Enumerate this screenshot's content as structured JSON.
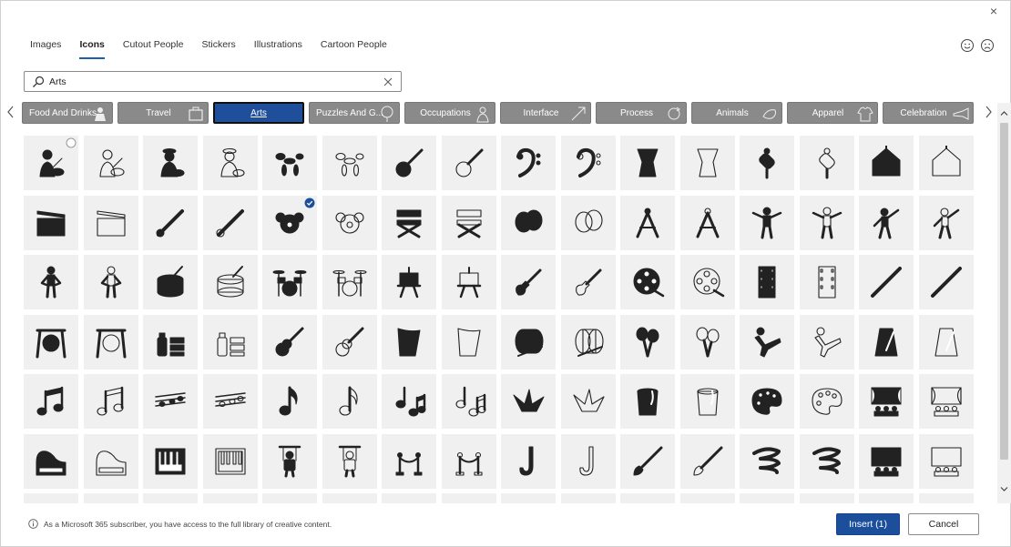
{
  "dialog": {
    "close_glyph": "×",
    "tabs": [
      {
        "label": "Images",
        "active": false
      },
      {
        "label": "Icons",
        "active": true
      },
      {
        "label": "Cutout People",
        "active": false
      },
      {
        "label": "Stickers",
        "active": false
      },
      {
        "label": "Illustrations",
        "active": false
      },
      {
        "label": "Cartoon People",
        "active": false
      }
    ],
    "feedback_icons": [
      "smile-icon",
      "frown-icon"
    ]
  },
  "search": {
    "value": "Arts",
    "placeholder": "Search"
  },
  "categories": [
    {
      "label": "Food And Drinks",
      "art": "dessert-icon",
      "active": false
    },
    {
      "label": "Travel",
      "art": "suitcase-icon",
      "active": false
    },
    {
      "label": "Arts",
      "art": "",
      "active": true
    },
    {
      "label": "Puzzles And G...",
      "art": "tree-icon",
      "active": false
    },
    {
      "label": "Occupations",
      "art": "worker-icon",
      "active": false
    },
    {
      "label": "Interface",
      "art": "arrows-icon",
      "active": false
    },
    {
      "label": "Process",
      "art": "cycle-icon",
      "active": false
    },
    {
      "label": "Animals",
      "art": "bird-icon",
      "active": false
    },
    {
      "label": "Apparel",
      "art": "shirt-icon",
      "active": false
    },
    {
      "label": "Celebration",
      "art": "horn-icon",
      "active": false
    }
  ],
  "icons": [
    {
      "name": "painter-icon",
      "filled": true,
      "mark": "circle"
    },
    {
      "name": "painter-icon",
      "filled": false
    },
    {
      "name": "painter-beret-icon",
      "filled": true
    },
    {
      "name": "painter-beret-icon",
      "filled": false
    },
    {
      "name": "balloon-dog-icon",
      "filled": true
    },
    {
      "name": "balloon-dog-icon",
      "filled": false
    },
    {
      "name": "banjo-icon",
      "filled": true
    },
    {
      "name": "banjo-icon",
      "filled": false
    },
    {
      "name": "bass-clef-icon",
      "filled": true
    },
    {
      "name": "bass-clef-icon",
      "filled": false
    },
    {
      "name": "djembe-icon",
      "filled": true
    },
    {
      "name": "djembe-icon",
      "filled": false
    },
    {
      "name": "chinese-knot-icon",
      "filled": true
    },
    {
      "name": "chinese-knot-icon",
      "filled": false
    },
    {
      "name": "circus-tent-icon",
      "filled": true
    },
    {
      "name": "circus-tent-icon",
      "filled": false
    },
    {
      "name": "clapperboard-icon",
      "filled": true
    },
    {
      "name": "clapperboard-icon",
      "filled": false
    },
    {
      "name": "clarinet-icon",
      "filled": true
    },
    {
      "name": "clarinet-icon",
      "filled": false
    },
    {
      "name": "clown-icon",
      "filled": true,
      "mark": "check"
    },
    {
      "name": "clown-icon",
      "filled": false
    },
    {
      "name": "director-chair-icon",
      "filled": true
    },
    {
      "name": "director-chair-icon",
      "filled": false
    },
    {
      "name": "theater-masks-icon",
      "filled": true
    },
    {
      "name": "theater-masks-icon",
      "filled": false
    },
    {
      "name": "drawing-compass-icon",
      "filled": true
    },
    {
      "name": "drawing-compass-icon",
      "filled": false
    },
    {
      "name": "mannequin-icon",
      "filled": true
    },
    {
      "name": "mannequin-icon",
      "filled": false
    },
    {
      "name": "mannequin-pose-icon",
      "filled": true
    },
    {
      "name": "mannequin-pose-icon",
      "filled": false
    },
    {
      "name": "mannequin-stand-icon",
      "filled": true
    },
    {
      "name": "mannequin-stand-icon",
      "filled": false
    },
    {
      "name": "drum-icon",
      "filled": true
    },
    {
      "name": "drum-icon",
      "filled": false
    },
    {
      "name": "drum-kit-icon",
      "filled": true
    },
    {
      "name": "drum-kit-icon",
      "filled": false
    },
    {
      "name": "easel-icon",
      "filled": true
    },
    {
      "name": "easel-icon",
      "filled": false
    },
    {
      "name": "electric-guitar-icon",
      "filled": true
    },
    {
      "name": "electric-guitar-icon",
      "filled": false
    },
    {
      "name": "film-reel-icon",
      "filled": true
    },
    {
      "name": "film-reel-icon",
      "filled": false
    },
    {
      "name": "film-strip-icon",
      "filled": true
    },
    {
      "name": "film-strip-icon",
      "filled": false
    },
    {
      "name": "flute-icon",
      "filled": true
    },
    {
      "name": "flute-icon",
      "filled": false
    },
    {
      "name": "gong-icon",
      "filled": true
    },
    {
      "name": "gong-icon",
      "filled": false
    },
    {
      "name": "graffiti-icon",
      "filled": true
    },
    {
      "name": "graffiti-icon",
      "filled": false
    },
    {
      "name": "acoustic-guitar-icon",
      "filled": true
    },
    {
      "name": "acoustic-guitar-icon",
      "filled": false
    },
    {
      "name": "harp-icon",
      "filled": true
    },
    {
      "name": "harp-icon",
      "filled": false
    },
    {
      "name": "marching-drum-icon",
      "filled": true
    },
    {
      "name": "marching-drum-icon",
      "filled": false
    },
    {
      "name": "maracas-icon",
      "filled": true
    },
    {
      "name": "maracas-icon",
      "filled": false
    },
    {
      "name": "martial-arts-icon",
      "filled": true
    },
    {
      "name": "martial-arts-icon",
      "filled": false
    },
    {
      "name": "metronome-icon",
      "filled": true
    },
    {
      "name": "metronome-icon",
      "filled": false
    },
    {
      "name": "beamed-notes-icon",
      "filled": true
    },
    {
      "name": "beamed-notes-icon",
      "filled": false
    },
    {
      "name": "sheet-music-icon",
      "filled": true
    },
    {
      "name": "sheet-music-icon",
      "filled": false
    },
    {
      "name": "eighth-note-icon",
      "filled": true
    },
    {
      "name": "eighth-note-icon",
      "filled": false
    },
    {
      "name": "music-notes-icon",
      "filled": true
    },
    {
      "name": "music-notes-icon",
      "filled": false
    },
    {
      "name": "origami-crane-icon",
      "filled": true
    },
    {
      "name": "origami-crane-icon",
      "filled": false
    },
    {
      "name": "paint-bucket-icon",
      "filled": true
    },
    {
      "name": "paint-bucket-icon",
      "filled": false
    },
    {
      "name": "palette-icon",
      "filled": true
    },
    {
      "name": "palette-icon",
      "filled": false
    },
    {
      "name": "stage-audience-icon",
      "filled": true
    },
    {
      "name": "stage-audience-icon",
      "filled": false
    },
    {
      "name": "grand-piano-icon",
      "filled": true
    },
    {
      "name": "grand-piano-icon",
      "filled": false
    },
    {
      "name": "piano-keys-icon",
      "filled": true
    },
    {
      "name": "piano-keys-icon",
      "filled": false
    },
    {
      "name": "marionette-icon",
      "filled": true
    },
    {
      "name": "marionette-icon",
      "filled": false
    },
    {
      "name": "rope-barrier-icon",
      "filled": true
    },
    {
      "name": "rope-barrier-icon",
      "filled": false
    },
    {
      "name": "saxophone-icon",
      "filled": true
    },
    {
      "name": "saxophone-icon",
      "filled": false
    },
    {
      "name": "paintbrush-icon",
      "filled": true
    },
    {
      "name": "paintbrush-icon",
      "filled": false
    },
    {
      "name": "brush-stroke-icon",
      "filled": true
    },
    {
      "name": "brush-stroke-icon",
      "filled": false
    },
    {
      "name": "theater-seats-icon",
      "filled": true
    },
    {
      "name": "theater-seats-icon",
      "filled": false
    },
    {
      "name": "partial-icon",
      "filled": true
    },
    {
      "name": "partial-icon",
      "filled": false
    },
    {
      "name": "partial-icon",
      "filled": true
    },
    {
      "name": "partial-icon",
      "filled": false
    },
    {
      "name": "partial-icon",
      "filled": true
    },
    {
      "name": "partial-icon",
      "filled": false
    },
    {
      "name": "partial-icon",
      "filled": true
    },
    {
      "name": "partial-icon",
      "filled": false
    },
    {
      "name": "partial-icon",
      "filled": true
    },
    {
      "name": "partial-icon",
      "filled": false
    },
    {
      "name": "partial-icon",
      "filled": true
    },
    {
      "name": "partial-icon",
      "filled": false
    },
    {
      "name": "partial-icon",
      "filled": true
    },
    {
      "name": "partial-icon",
      "filled": false
    },
    {
      "name": "partial-icon",
      "filled": true
    },
    {
      "name": "partial-icon",
      "filled": false
    }
  ],
  "footer": {
    "info": "As a Microsoft 365 subscriber, you have access to the full library of creative content.",
    "insert_label": "Insert (1)",
    "cancel_label": "Cancel"
  },
  "colors": {
    "accent": "#1b4f9c",
    "category_bg": "#8a8a8a",
    "tile_bg": "#f0f0f0",
    "icon_fill": "#222222"
  }
}
